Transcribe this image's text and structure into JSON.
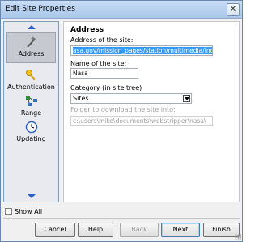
{
  "window": {
    "title": "Edit Site Properties",
    "close_glyph": "✕"
  },
  "sidebar": {
    "items": [
      {
        "label": "Address",
        "icon": "wand-icon",
        "selected": true
      },
      {
        "label": "Authentication",
        "icon": "keys-icon",
        "selected": false
      },
      {
        "label": "Range",
        "icon": "network-icon",
        "selected": false
      },
      {
        "label": "Updating",
        "icon": "clock-icon",
        "selected": false
      }
    ]
  },
  "panel": {
    "section_title": "Address",
    "address_label": "Address of the site:",
    "address_value": "asa.gov/mission_pages/station/multimedia/index.htm",
    "name_label": "Name of the site:",
    "name_value": "Nasa",
    "category_label": "Category (in site tree)",
    "category_value": "Sites",
    "folder_label": "Folder to download the site into:",
    "folder_value": "c:\\users\\mike\\documents\\webstripper\\nasa\\"
  },
  "show_all_label": "Show All",
  "buttons": {
    "cancel": "Cancel",
    "help": "Help",
    "back": "Back",
    "next": "Next",
    "finish": "Finish"
  },
  "colors": {
    "accent": "#2c62c4",
    "selection": "#3399ff",
    "titlebar": "#b9d1ee"
  }
}
